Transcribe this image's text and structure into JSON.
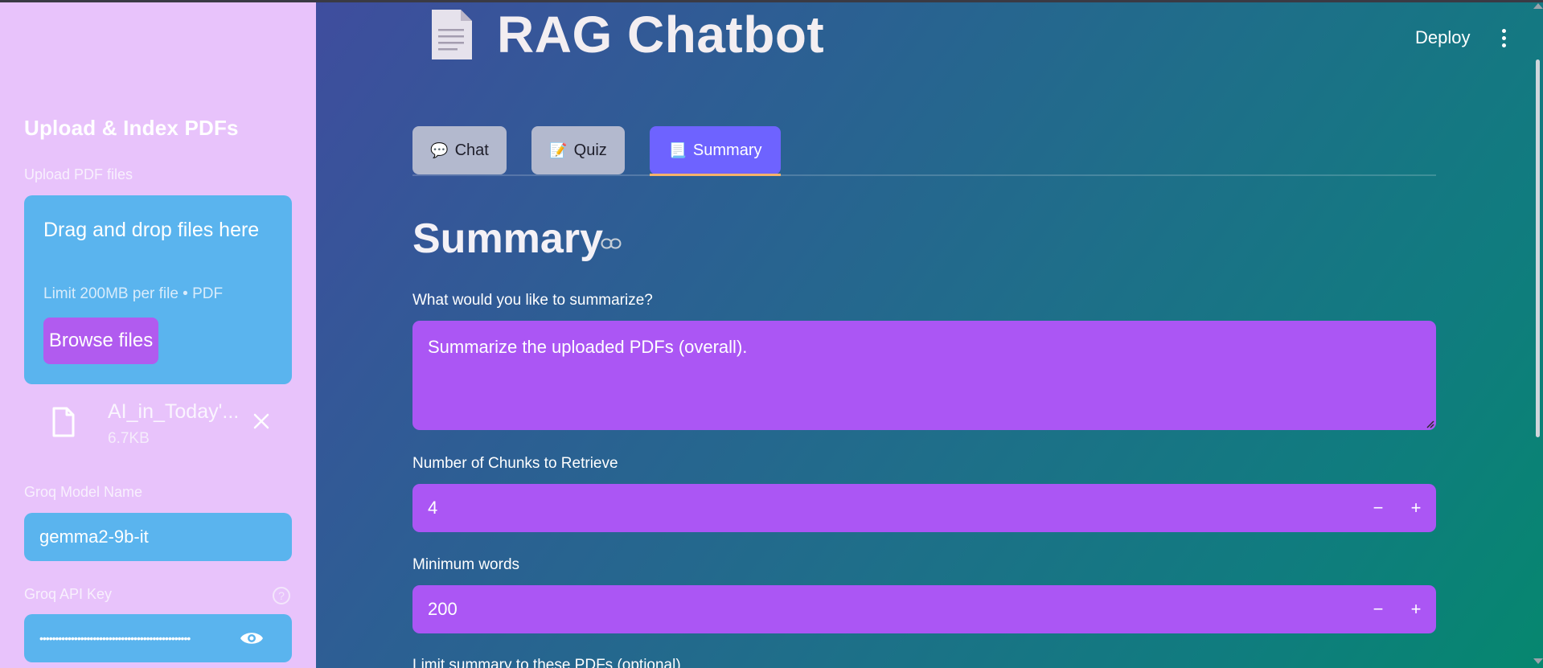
{
  "sidebar": {
    "header": "Upload & Index PDFs",
    "upload_label": "Upload PDF files",
    "dropzone": {
      "title": "Drag and drop files here",
      "limit": "Limit 200MB per file • PDF",
      "browse_label": "Browse files"
    },
    "file": {
      "name": "AI_in_Today'...",
      "size": "6.7KB",
      "icon": "file-icon"
    },
    "model": {
      "label": "Groq Model Name",
      "value": "gemma2-9b-it"
    },
    "api_key": {
      "label": "Groq API Key",
      "value": "••••••••••••••••••••••••••••••••••••••••••••••••"
    }
  },
  "header": {
    "title": "RAG Chatbot",
    "deploy_label": "Deploy"
  },
  "tabs": [
    {
      "icon": "💬",
      "label": "Chat",
      "active": false
    },
    {
      "icon": "📝",
      "label": "Quiz",
      "active": false
    },
    {
      "icon": "📃",
      "label": "Summary",
      "active": true
    }
  ],
  "main": {
    "section_title": "Summary",
    "prompt_label": "What would you like to summarize?",
    "prompt_value": "Summarize the uploaded PDFs (overall).",
    "chunks_label": "Number of Chunks to Retrieve",
    "chunks_value": "4",
    "min_words_label": "Minimum words",
    "min_words_value": "200",
    "limit_label": "Limit summary to these PDFs (optional)"
  },
  "colors": {
    "sidebar_bg": "#e8c3fb",
    "sidebar_input": "#5ab4ee",
    "accent_purple": "#ab56f4",
    "tab_active": "#6e63ff",
    "tab_underline": "#f6b26b"
  }
}
